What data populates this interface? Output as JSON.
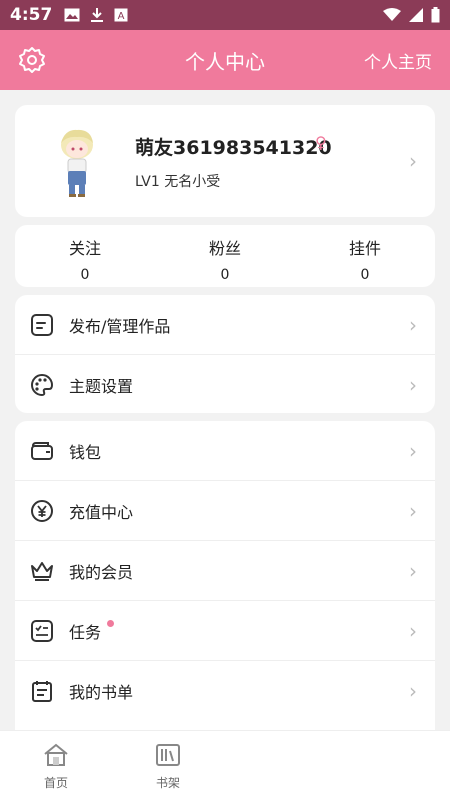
{
  "status_bar": {
    "time": "4:57",
    "icons": [
      "image-icon",
      "download-icon",
      "a-icon"
    ],
    "right_icons": [
      "wifi-icon",
      "signal-icon",
      "battery-icon"
    ]
  },
  "header": {
    "title": "个人中心",
    "homepage_label": "个人主页",
    "settings_icon": "gear-icon"
  },
  "profile": {
    "nickname": "萌友361983541320",
    "gender_symbol": "♀",
    "level_text": "LV1 无名小受"
  },
  "stats": [
    {
      "label": "关注",
      "value": "0"
    },
    {
      "label": "粉丝",
      "value": "0"
    },
    {
      "label": "挂件",
      "value": "0"
    }
  ],
  "menu_group_1": [
    {
      "label": "发布/管理作品",
      "icon": "edit-doc-icon"
    },
    {
      "label": "主题设置",
      "icon": "palette-icon"
    }
  ],
  "menu_group_2": [
    {
      "label": "钱包",
      "icon": "wallet-icon"
    },
    {
      "label": "充值中心",
      "icon": "yen-icon"
    },
    {
      "label": "我的会员",
      "icon": "crown-icon"
    },
    {
      "label": "任务",
      "icon": "task-icon",
      "badge": true
    },
    {
      "label": "我的书单",
      "icon": "booklist-icon"
    }
  ],
  "tab_bar": [
    {
      "label": "首页",
      "icon": "home-icon"
    },
    {
      "label": "书架",
      "icon": "bookshelf-icon"
    }
  ],
  "colors": {
    "accent": "#f07a9c",
    "status_bar": "#8b3b57",
    "background": "#f2f2f2"
  }
}
